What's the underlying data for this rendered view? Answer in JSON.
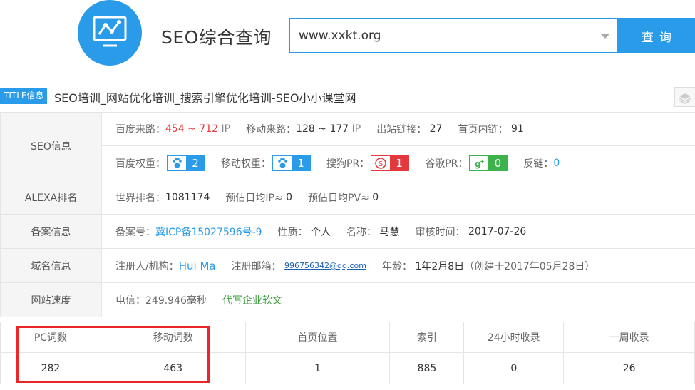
{
  "header": {
    "site_title": "SEO综合查询",
    "search_value": "www.xxkt.org",
    "search_button": "查询",
    "brand_color": "#2a9be8"
  },
  "title_row": {
    "badge": "TITLE信息",
    "text": "SEO培训_网站优化培训_搜索引擎优化培训-SEO小小课堂网"
  },
  "seo_info": {
    "label": "SEO信息",
    "baidu_traffic_label": "百度来路：",
    "baidu_traffic_value": "454 ~ 712",
    "baidu_traffic_unit": "IP",
    "mobile_traffic_label": "移动来路：",
    "mobile_traffic_value": "128 ~ 177",
    "mobile_traffic_unit": "IP",
    "outbound_label": "出站链接：",
    "outbound_value": "27",
    "internal_label": "首页内链：",
    "internal_value": "91",
    "baidu_weight_label": "百度权重：",
    "baidu_weight_value": "2",
    "mobile_weight_label": "移动权重：",
    "mobile_weight_value": "1",
    "sogou_pr_label": "搜狗PR：",
    "sogou_pr_value": "1",
    "google_pr_label": "谷歌PR：",
    "google_pr_value": "0",
    "backlinks_label": "反链：",
    "backlinks_value": "0"
  },
  "alexa": {
    "label": "ALEXA排名",
    "world_rank_label": "世界排名：",
    "world_rank_value": "1081174",
    "daily_ip_label": "预估日均IP≈",
    "daily_ip_value": "0",
    "daily_pv_label": "预估日均PV≈",
    "daily_pv_value": "0"
  },
  "icp": {
    "label": "备案信息",
    "icp_label": "备案号：",
    "icp_value": "冀ICP备15027596号-9",
    "nature_label": "性质：",
    "nature_value": "个人",
    "name_label": "名称：",
    "name_value": "马慧",
    "audit_label": "审核时间：",
    "audit_value": "2017-07-26"
  },
  "domain": {
    "label": "域名信息",
    "registrant_label": "注册人/机构：",
    "registrant_value": "Hui Ma",
    "email_label": "注册邮箱：",
    "email_value": "996756342@qq.com",
    "age_label": "年龄：",
    "age_value": "1年2月8日",
    "age_note": "（创建于2017年05月28日）"
  },
  "speed": {
    "label": "网站速度",
    "telecom_value": "电信：249.946毫秒",
    "ad_link": "代写企业软文"
  },
  "stats": {
    "headers": [
      "PC词数",
      "移动词数",
      "首页位置",
      "索引",
      "24小时收录",
      "一周收录"
    ],
    "values": [
      "282",
      "463",
      "1",
      "885",
      "0",
      "26"
    ]
  }
}
